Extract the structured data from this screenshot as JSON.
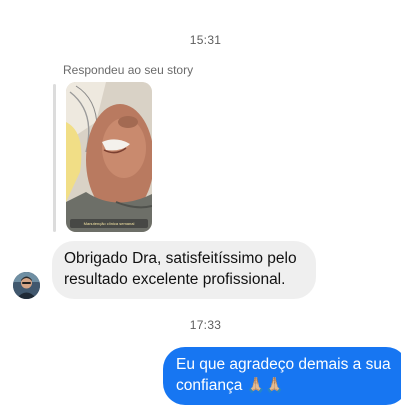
{
  "thread": {
    "timestamp_1": "15:31",
    "timestamp_2": "17:33"
  },
  "story_reply": {
    "caption": "Respondeu ao seu story",
    "story_overlay_text": "Manutenção clínica semanal"
  },
  "incoming_message": {
    "line1": "Obrigado Dra, satisfeitíssimo pelo",
    "line2": "resultado excelente profissional."
  },
  "outgoing_message": {
    "line1": "Eu que agradeço demais a sua",
    "line2": "confiança",
    "emoji": "🙏🏼🙏🏼"
  },
  "colors": {
    "outgoing_bubble": "#1776f2",
    "incoming_bubble": "#efefef",
    "timestamp_text": "#5d5d5d"
  },
  "icons": {
    "avatar": "contact-avatar",
    "story": "story-thumbnail"
  }
}
